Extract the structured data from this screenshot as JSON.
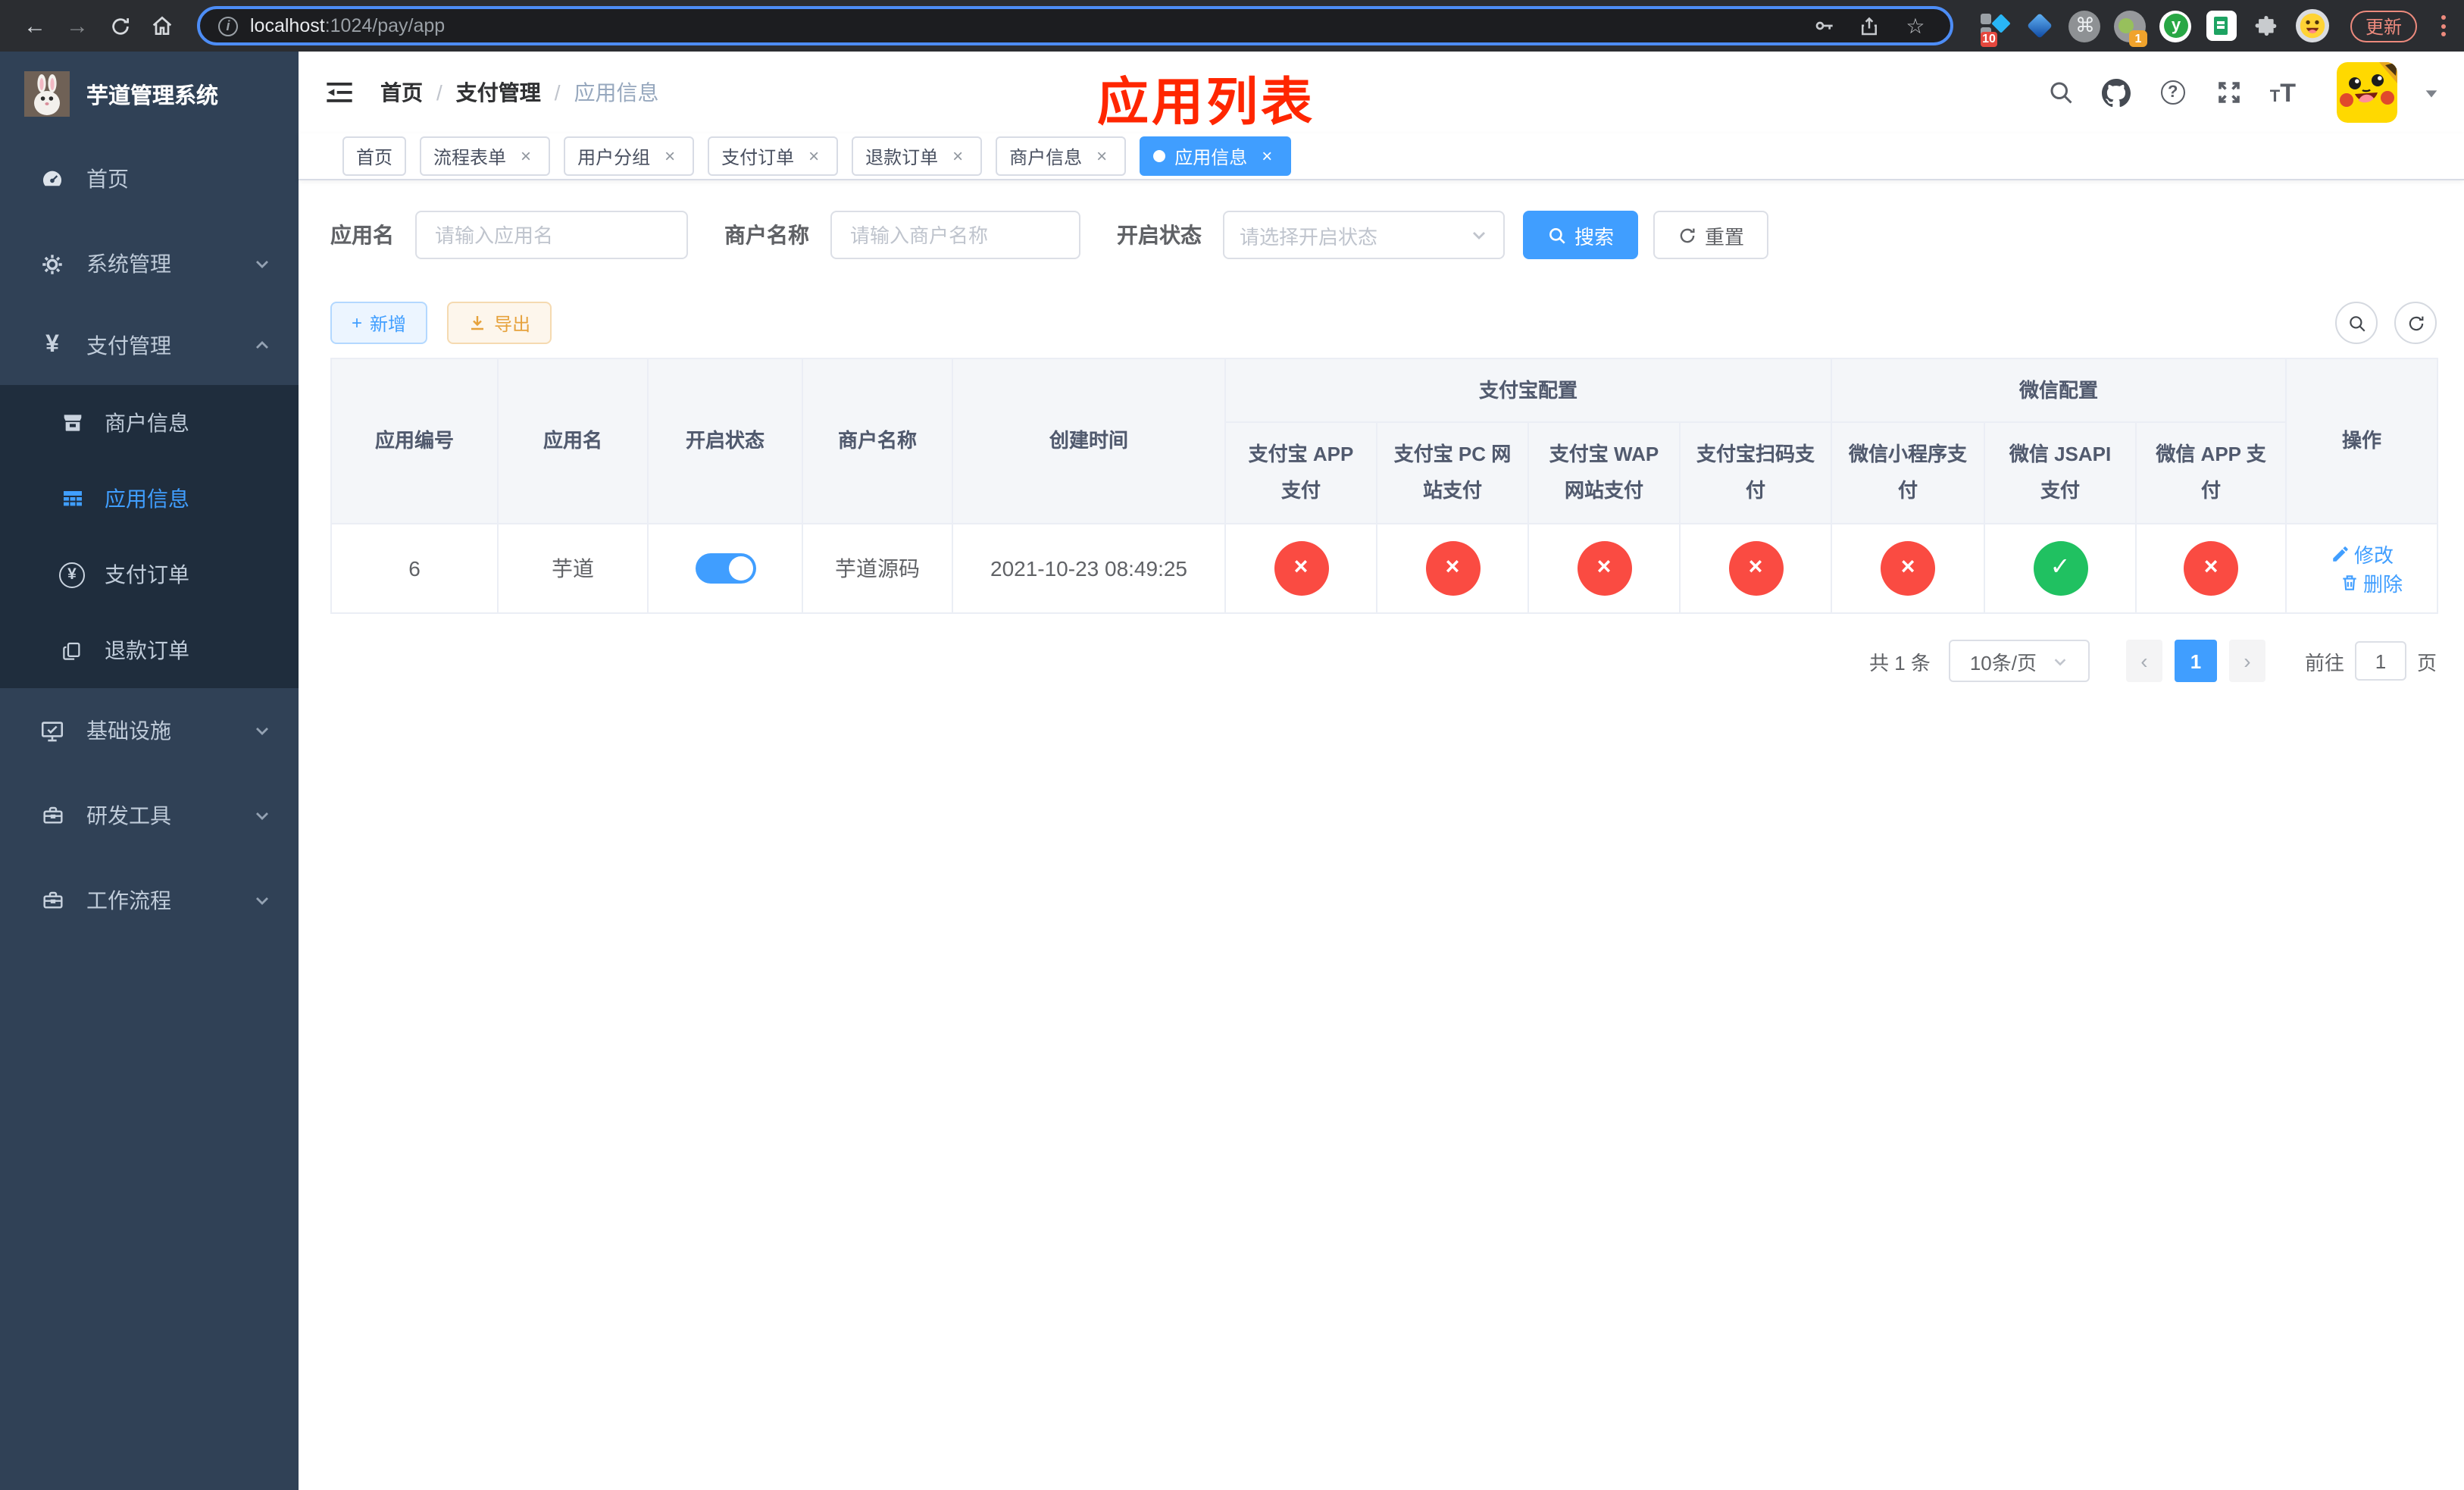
{
  "browser": {
    "url_host": "localhost",
    "url_rest": ":1024/pay/app",
    "update_label": "更新",
    "ext_badge_10": "10",
    "ext_badge_1": "1",
    "ext_y": "y"
  },
  "ui": {
    "back": "←",
    "forward": "→",
    "star": "☆",
    "info": "i",
    "command": "⌘",
    "close": "×",
    "sep": "/",
    "plus": "+",
    "prev": "‹",
    "next": "›",
    "question": "?",
    "yen": "¥",
    "font_icon": "T",
    "check": "✓",
    "cross": "×"
  },
  "sidebar": {
    "title": "芋道管理系统",
    "items": [
      {
        "label": "首页",
        "icon": "dashboard-icon"
      },
      {
        "label": "系统管理",
        "icon": "gear-icon"
      },
      {
        "label": "支付管理",
        "icon": "yen-icon",
        "expanded": true,
        "children": [
          {
            "label": "商户信息",
            "icon": "shop-icon"
          },
          {
            "label": "应用信息",
            "icon": "table-icon",
            "active": true
          },
          {
            "label": "支付订单",
            "icon": "yen-circle-icon"
          },
          {
            "label": "退款订单",
            "icon": "copy-icon"
          }
        ]
      },
      {
        "label": "基础设施",
        "icon": "monitor-icon"
      },
      {
        "label": "研发工具",
        "icon": "toolbox-icon"
      },
      {
        "label": "工作流程",
        "icon": "toolbox-icon"
      }
    ]
  },
  "navbar": {
    "breadcrumb": [
      "首页",
      "支付管理",
      "应用信息"
    ]
  },
  "annotation": "应用列表",
  "tabs": [
    {
      "label": "首页",
      "closable": false,
      "active": false
    },
    {
      "label": "流程表单",
      "closable": true,
      "active": false
    },
    {
      "label": "用户分组",
      "closable": true,
      "active": false
    },
    {
      "label": "支付订单",
      "closable": true,
      "active": false
    },
    {
      "label": "退款订单",
      "closable": true,
      "active": false
    },
    {
      "label": "商户信息",
      "closable": true,
      "active": false
    },
    {
      "label": "应用信息",
      "closable": true,
      "active": true
    }
  ],
  "filters": {
    "app_name": {
      "label": "应用名",
      "placeholder": "请输入应用名"
    },
    "merchant_name": {
      "label": "商户名称",
      "placeholder": "请输入商户名称"
    },
    "status": {
      "label": "开启状态",
      "placeholder": "请选择开启状态"
    },
    "search_label": "搜索",
    "reset_label": "重置"
  },
  "toolbar": {
    "add_label": "新增",
    "export_label": "导出"
  },
  "table": {
    "groups": {
      "alipay": "支付宝配置",
      "wechat": "微信配置"
    },
    "columns": [
      "应用编号",
      "应用名",
      "开启状态",
      "商户名称",
      "创建时间",
      "支付宝 APP 支付",
      "支付宝 PC 网站支付",
      "支付宝 WAP 网站支付",
      "支付宝扫码支付",
      "微信小程序支付",
      "微信 JSAPI 支付",
      "微信 APP 支付",
      "操作"
    ],
    "rows": [
      {
        "id": "6",
        "name": "芋道",
        "enabled": true,
        "merchant": "芋道源码",
        "created": "2021-10-23 08:49:25",
        "channels": [
          false,
          false,
          false,
          false,
          false,
          true,
          false
        ],
        "actions": [
          "修改",
          "删除"
        ]
      }
    ]
  },
  "pagination": {
    "total": "共 1 条",
    "page_size": "10条/页",
    "current": "1",
    "goto_label": "前往",
    "goto_value": "1",
    "unit": "页"
  }
}
